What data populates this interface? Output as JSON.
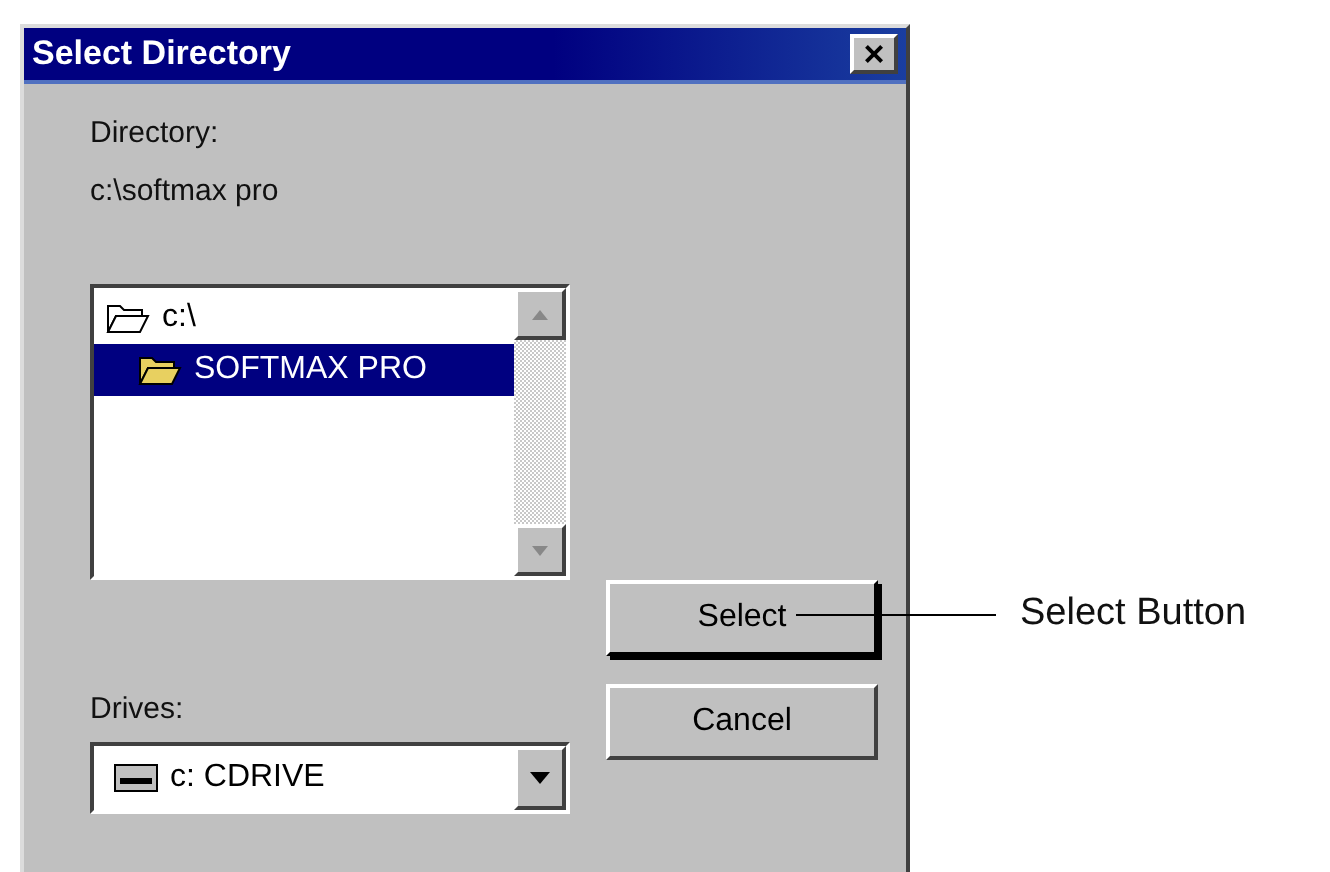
{
  "window": {
    "title": "Select Directory",
    "close": "×"
  },
  "directory": {
    "label": "Directory:",
    "path": "c:\\softmax pro"
  },
  "folders": [
    {
      "name": "c:\\",
      "selected": false
    },
    {
      "name": "SOFTMAX PRO",
      "selected": true
    }
  ],
  "drives": {
    "label": "Drives:",
    "value": "c: CDRIVE"
  },
  "buttons": [
    {
      "label": "Select",
      "default": true
    },
    {
      "label": "Cancel",
      "default": false
    }
  ],
  "callout": {
    "text": "Select Button"
  }
}
